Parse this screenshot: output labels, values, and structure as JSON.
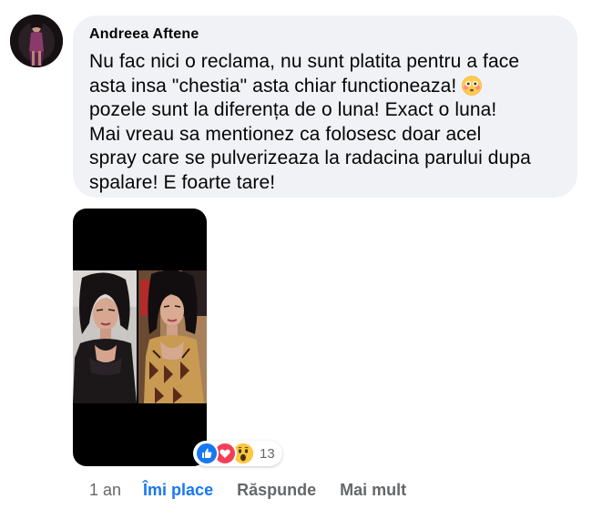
{
  "comment": {
    "author": "Andreea Aftene",
    "lines": [
      "Nu fac nici o reclama, nu sunt platita pentru a face",
      "asta insa \"chestia\" asta chiar functioneaza!",
      "pozele sunt la diferența de o luna! Exact o luna!",
      "Mai vreau sa mentionez ca folosesc doar acel",
      "spray care se pulverizeaza la radacina parului dupa",
      "spalare! E foarte tare!"
    ],
    "emoji": "flushed-face-icon"
  },
  "reactions": {
    "icons": [
      "like-icon",
      "love-icon",
      "wow-icon"
    ],
    "count": "13"
  },
  "actions": {
    "time": "1 an",
    "like_label": "Îmi place",
    "reply_label": "Răspunde",
    "more_label": "Mai mult"
  },
  "colors": {
    "bubble": "#f0f2f5",
    "accent": "#1877f2",
    "secondary_text": "#65676b"
  }
}
